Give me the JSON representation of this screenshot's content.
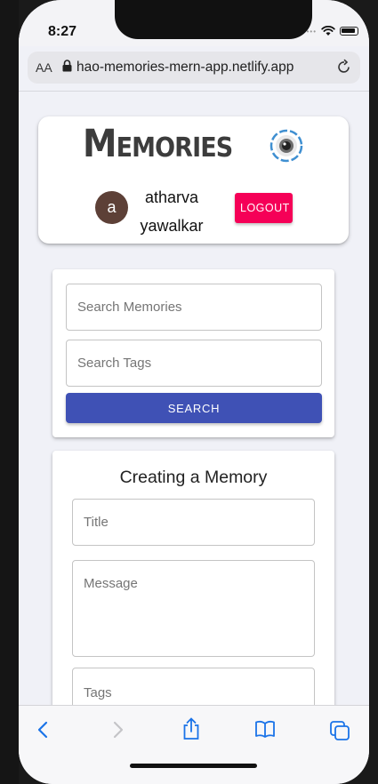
{
  "status": {
    "time": "8:27"
  },
  "browser": {
    "text_size_label": "AA",
    "url": "hao-memories-mern-app.netlify.app"
  },
  "header": {
    "title": "Memories",
    "avatar_letter": "a",
    "user_first": "atharva",
    "user_last": "yawalkar",
    "logout_label": "LOGOUT"
  },
  "search": {
    "memories_placeholder": "Search Memories",
    "tags_placeholder": "Search Tags",
    "button_label": "SEARCH"
  },
  "form": {
    "heading": "Creating a Memory",
    "title_placeholder": "Title",
    "message_placeholder": "Message",
    "tags_placeholder": "Tags"
  },
  "colors": {
    "logout": "#f50057",
    "search_button": "#3f51b5",
    "avatar": "#5d4037",
    "toolbar_active": "#1a73e8"
  }
}
